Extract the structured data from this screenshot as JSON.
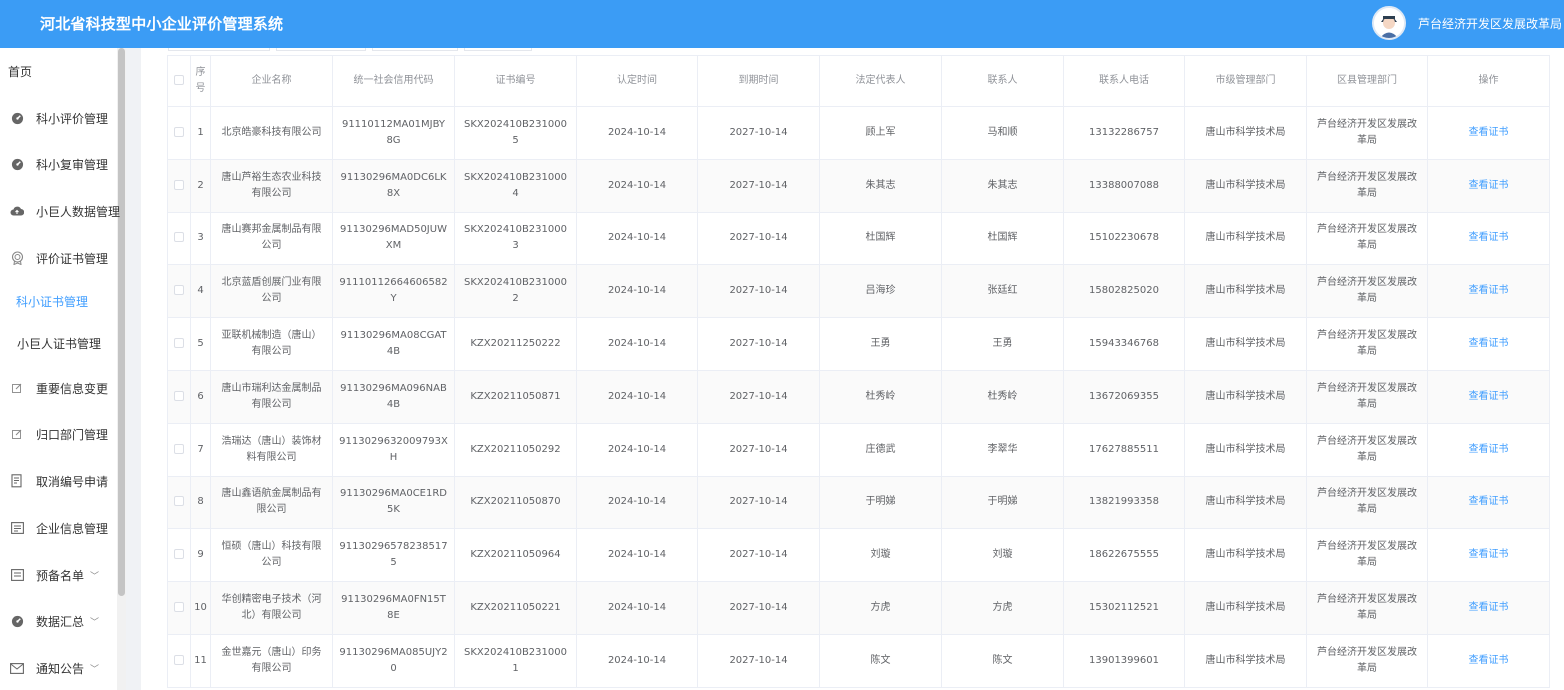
{
  "header": {
    "title": "河北省科技型中小企业评价管理系统",
    "user": "芦台经济开发区发展改革局"
  },
  "sidebar": {
    "home": "首页",
    "items": [
      {
        "label": "科小评价管理",
        "icon": "gauge-icon"
      },
      {
        "label": "科小复审管理",
        "icon": "gauge-icon"
      },
      {
        "label": "小巨人数据管理",
        "icon": "cloud-upload-icon"
      },
      {
        "label": "评价证书管理",
        "icon": "medal-icon"
      },
      {
        "label": "重要信息变更",
        "icon": "edit-icon"
      },
      {
        "label": "归口部门管理",
        "icon": "edit-icon"
      },
      {
        "label": "取消编号申请",
        "icon": "document-icon"
      },
      {
        "label": "企业信息管理",
        "icon": "id-card-icon"
      },
      {
        "label": "预备名单",
        "icon": "list-icon"
      },
      {
        "label": "数据汇总",
        "icon": "gauge-icon"
      },
      {
        "label": "通知公告",
        "icon": "mail-icon"
      }
    ],
    "subitems": [
      {
        "label": "科小证书管理"
      },
      {
        "label": "小巨人证书管理"
      }
    ]
  },
  "table": {
    "headers": [
      "序号",
      "企业名称",
      "统一社会信用代码",
      "证书编号",
      "认定时间",
      "到期时间",
      "法定代表人",
      "联系人",
      "联系人电话",
      "市级管理部门",
      "区县管理部门",
      "操作"
    ],
    "rows": [
      [
        "1",
        "北京皓豪科技有限公司",
        "91110112MA01MJBY8G",
        "SKX202410B2310005",
        "2024-10-14",
        "2027-10-14",
        "顾上军",
        "马和顺",
        "13132286757",
        "唐山市科学技术局",
        "芦台经济开发区发展改革局",
        "查看证书"
      ],
      [
        "2",
        "唐山芦裕生态农业科技有限公司",
        "91130296MA0DC6LK8X",
        "SKX202410B2310004",
        "2024-10-14",
        "2027-10-14",
        "朱其志",
        "朱其志",
        "13388007088",
        "唐山市科学技术局",
        "芦台经济开发区发展改革局",
        "查看证书"
      ],
      [
        "3",
        "唐山赛邦金属制品有限公司",
        "91130296MAD50JUWXM",
        "SKX202410B2310003",
        "2024-10-14",
        "2027-10-14",
        "杜国辉",
        "杜国辉",
        "15102230678",
        "唐山市科学技术局",
        "芦台经济开发区发展改革局",
        "查看证书"
      ],
      [
        "4",
        "北京蓝盾创展门业有限公司",
        "91110112664606582Y",
        "SKX202410B2310002",
        "2024-10-14",
        "2027-10-14",
        "吕海珍",
        "张廷红",
        "15802825020",
        "唐山市科学技术局",
        "芦台经济开发区发展改革局",
        "查看证书"
      ],
      [
        "5",
        "亚联机械制造（唐山）有限公司",
        "91130296MA08CGAT4B",
        "KZX20211250222",
        "2024-10-14",
        "2027-10-14",
        "王勇",
        "王勇",
        "15943346768",
        "唐山市科学技术局",
        "芦台经济开发区发展改革局",
        "查看证书"
      ],
      [
        "6",
        "唐山市瑞利达金属制品有限公司",
        "91130296MA096NAB4B",
        "KZX20211050871",
        "2024-10-14",
        "2027-10-14",
        "杜秀岭",
        "杜秀岭",
        "13672069355",
        "唐山市科学技术局",
        "芦台经济开发区发展改革局",
        "查看证书"
      ],
      [
        "7",
        "浩瑞达（唐山）装饰材料有限公司",
        "9113029632009793XH",
        "KZX20211050292",
        "2024-10-14",
        "2027-10-14",
        "庄德武",
        "李翠华",
        "17627885511",
        "唐山市科学技术局",
        "芦台经济开发区发展改革局",
        "查看证书"
      ],
      [
        "8",
        "唐山鑫语航金属制品有限公司",
        "91130296MA0CE1RD5K",
        "KZX20211050870",
        "2024-10-14",
        "2027-10-14",
        "于明娣",
        "于明娣",
        "13821993358",
        "唐山市科学技术局",
        "芦台经济开发区发展改革局",
        "查看证书"
      ],
      [
        "9",
        "恒硕（唐山）科技有限公司",
        "911302965782385175",
        "KZX20211050964",
        "2024-10-14",
        "2027-10-14",
        "刘璇",
        "刘璇",
        "18622675555",
        "唐山市科学技术局",
        "芦台经济开发区发展改革局",
        "查看证书"
      ],
      [
        "10",
        "华创精密电子技术（河北）有限公司",
        "91130296MA0FN15T8E",
        "KZX20211050221",
        "2024-10-14",
        "2027-10-14",
        "方虎",
        "方虎",
        "15302112521",
        "唐山市科学技术局",
        "芦台经济开发区发展改革局",
        "查看证书"
      ],
      [
        "11",
        "金世嘉元（唐山）印务有限公司",
        "91130296MA085UJY20",
        "SKX202410B2310001",
        "2024-10-14",
        "2027-10-14",
        "陈文",
        "陈文",
        "13901399601",
        "唐山市科学技术局",
        "芦台经济开发区发展改革局",
        "查看证书"
      ]
    ]
  }
}
